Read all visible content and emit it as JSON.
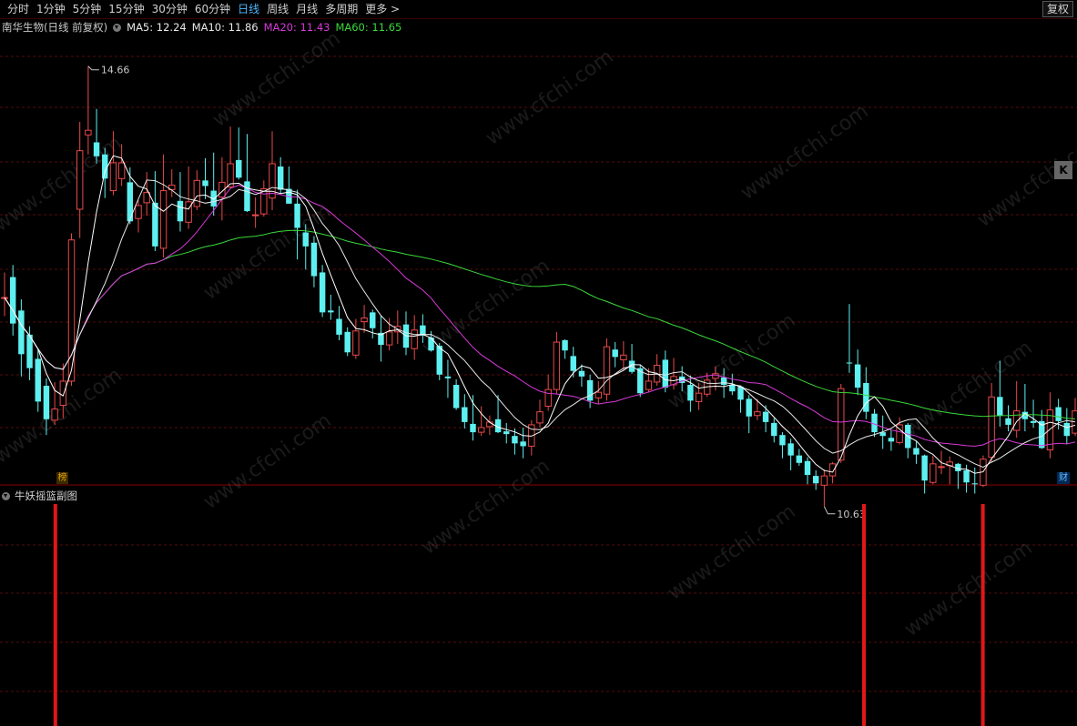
{
  "toolbar": {
    "periods": [
      "分时",
      "1分钟",
      "5分钟",
      "15分钟",
      "30分钟",
      "60分钟",
      "日线",
      "周线",
      "月线",
      "多周期",
      "更多 >"
    ],
    "active_index": 6,
    "right_button": "复权"
  },
  "main_panel": {
    "stock_title": "南华生物(日线 前复权)",
    "indicators": [
      {
        "label": "MA5: 12.24",
        "color": "#e8e8e8"
      },
      {
        "label": "MA10: 11.86",
        "color": "#e8e8e8"
      },
      {
        "label": "MA20: 11.43",
        "color": "#d83ad8"
      },
      {
        "label": "MA60: 11.65",
        "color": "#3ad83a"
      }
    ],
    "high_label": "14.66",
    "low_label": "10.63",
    "rank_badge": "榜",
    "finance_badge": "财",
    "side_icon": "K"
  },
  "sub_panel": {
    "title": "牛妖摇篮副图"
  },
  "watermark": "www.cfchi.com",
  "colors": {
    "up": "#e84a4a",
    "down": "#5ef0f0",
    "ma5": "#ffffff",
    "ma10": "#e8e8e8",
    "ma20": "#d83ad8",
    "ma60": "#3ad83a",
    "signal": "#e01818",
    "grid": "#5a0a0a"
  },
  "chart_data": {
    "type": "candlestick",
    "price_range": [
      10.3,
      15.0
    ],
    "candles": [
      [
        12.17,
        12.17,
        12.44,
        11.97
      ],
      [
        12.39,
        11.89,
        12.52,
        11.76
      ],
      [
        12.03,
        11.56,
        12.15,
        11.32
      ],
      [
        11.77,
        11.41,
        11.86,
        11.28
      ],
      [
        11.51,
        11.05,
        11.62,
        10.94
      ],
      [
        11.22,
        10.86,
        11.3,
        10.69
      ],
      [
        10.85,
        10.97,
        11.26,
        10.8
      ],
      [
        11.01,
        11.27,
        11.46,
        10.87
      ],
      [
        11.27,
        12.79,
        12.86,
        11.22
      ],
      [
        13.12,
        13.75,
        14.06,
        12.81
      ],
      [
        13.92,
        13.97,
        14.66,
        13.71
      ],
      [
        13.84,
        13.69,
        14.2,
        13.61
      ],
      [
        13.71,
        13.45,
        13.78,
        13.24
      ],
      [
        13.32,
        13.62,
        13.96,
        13.27
      ],
      [
        13.45,
        13.62,
        13.82,
        13.37
      ],
      [
        13.41,
        12.99,
        13.57,
        12.96
      ],
      [
        13.02,
        13.16,
        13.22,
        12.87
      ],
      [
        13.19,
        13.3,
        13.52,
        13.05
      ],
      [
        13.19,
        12.72,
        13.53,
        12.67
      ],
      [
        12.7,
        13.32,
        13.71,
        12.6
      ],
      [
        13.33,
        13.38,
        13.55,
        13.25
      ],
      [
        13.21,
        12.99,
        13.52,
        12.88
      ],
      [
        12.98,
        13.2,
        13.58,
        12.91
      ],
      [
        13.15,
        13.43,
        13.54,
        13.11
      ],
      [
        13.43,
        13.37,
        13.67,
        13.23
      ],
      [
        13.32,
        13.15,
        13.73,
        13.05
      ],
      [
        13.25,
        13.41,
        13.68,
        13.0
      ],
      [
        13.36,
        13.61,
        14.01,
        13.34
      ],
      [
        13.65,
        13.46,
        14.0,
        13.44
      ],
      [
        13.42,
        13.1,
        13.93,
        13.09
      ],
      [
        13.06,
        13.06,
        13.25,
        12.92
      ],
      [
        13.07,
        13.34,
        13.43,
        13.04
      ],
      [
        13.24,
        13.61,
        13.96,
        13.11
      ],
      [
        13.58,
        13.33,
        13.68,
        13.29
      ],
      [
        13.34,
        13.18,
        13.58,
        13.18
      ],
      [
        13.18,
        12.92,
        13.33,
        12.58
      ],
      [
        12.87,
        12.72,
        12.96,
        12.47
      ],
      [
        12.76,
        12.4,
        12.83,
        12.28
      ],
      [
        12.44,
        12.01,
        12.52,
        11.96
      ],
      [
        12.03,
        12.01,
        12.2,
        11.93
      ],
      [
        11.94,
        11.77,
        12.08,
        11.71
      ],
      [
        11.8,
        11.58,
        11.85,
        11.54
      ],
      [
        11.55,
        11.81,
        11.94,
        11.51
      ],
      [
        11.91,
        11.95,
        12.09,
        11.79
      ],
      [
        12.01,
        11.84,
        12.04,
        11.73
      ],
      [
        11.79,
        11.66,
        11.98,
        11.48
      ],
      [
        11.66,
        11.8,
        11.95,
        11.6
      ],
      [
        11.8,
        11.86,
        12.03,
        11.67
      ],
      [
        11.88,
        11.63,
        12.02,
        11.55
      ],
      [
        11.62,
        11.82,
        11.98,
        11.5
      ],
      [
        11.87,
        11.76,
        11.99,
        11.68
      ],
      [
        11.74,
        11.6,
        11.81,
        11.59
      ],
      [
        11.65,
        11.34,
        11.68,
        11.28
      ],
      [
        11.32,
        11.3,
        11.5,
        11.09
      ],
      [
        11.23,
        10.98,
        11.29,
        10.96
      ],
      [
        10.99,
        10.83,
        11.13,
        10.76
      ],
      [
        10.81,
        10.72,
        11.12,
        10.63
      ],
      [
        10.72,
        10.77,
        11.0,
        10.68
      ],
      [
        10.78,
        10.83,
        10.9,
        10.69
      ],
      [
        10.86,
        10.72,
        11.12,
        10.71
      ],
      [
        10.73,
        10.7,
        10.82,
        10.6
      ],
      [
        10.68,
        10.6,
        10.76,
        10.48
      ],
      [
        10.62,
        10.57,
        10.77,
        10.44
      ],
      [
        10.57,
        10.8,
        10.85,
        10.47
      ],
      [
        10.82,
        10.94,
        11.07,
        10.77
      ],
      [
        11.0,
        11.18,
        11.34,
        10.95
      ],
      [
        11.18,
        11.69,
        11.8,
        11.13
      ],
      [
        11.71,
        11.6,
        11.72,
        11.51
      ],
      [
        11.54,
        11.38,
        11.64,
        11.31
      ],
      [
        11.38,
        11.32,
        11.45,
        11.21
      ],
      [
        11.28,
        11.06,
        11.34,
        10.98
      ],
      [
        11.09,
        11.15,
        11.27,
        11.02
      ],
      [
        11.13,
        11.64,
        11.73,
        11.06
      ],
      [
        11.61,
        11.53,
        11.69,
        11.42
      ],
      [
        11.5,
        11.55,
        11.7,
        11.38
      ],
      [
        11.49,
        11.37,
        11.67,
        11.35
      ],
      [
        11.41,
        11.14,
        11.45,
        11.1
      ],
      [
        11.18,
        11.27,
        11.41,
        11.15
      ],
      [
        11.26,
        11.44,
        11.56,
        11.22
      ],
      [
        11.5,
        11.2,
        11.6,
        11.15
      ],
      [
        11.23,
        11.32,
        11.52,
        11.18
      ],
      [
        11.32,
        11.25,
        11.43,
        11.16
      ],
      [
        11.23,
        11.06,
        11.33,
        10.94
      ],
      [
        11.05,
        11.14,
        11.25,
        10.96
      ],
      [
        11.13,
        11.28,
        11.36,
        11.1
      ],
      [
        11.3,
        11.35,
        11.43,
        11.17
      ],
      [
        11.31,
        11.23,
        11.41,
        11.09
      ],
      [
        11.23,
        11.16,
        11.35,
        11.12
      ],
      [
        11.21,
        11.07,
        11.21,
        10.93
      ],
      [
        11.08,
        10.89,
        11.12,
        10.71
      ],
      [
        10.9,
        10.94,
        11.08,
        10.85
      ],
      [
        10.94,
        10.83,
        11.01,
        10.72
      ],
      [
        10.82,
        10.68,
        10.87,
        10.61
      ],
      [
        10.69,
        10.58,
        10.72,
        10.44
      ],
      [
        10.6,
        10.47,
        10.65,
        10.31
      ],
      [
        10.47,
        10.39,
        10.54,
        10.36
      ],
      [
        10.41,
        10.26,
        10.45,
        10.16
      ],
      [
        10.25,
        10.17,
        10.31,
        10.1
      ],
      [
        10.15,
        10.25,
        10.32,
        9.92
      ],
      [
        10.25,
        10.38,
        10.4,
        10.17
      ],
      [
        10.42,
        11.19,
        11.24,
        10.39
      ],
      [
        11.47,
        11.46,
        12.1,
        11.36
      ],
      [
        11.45,
        11.2,
        11.61,
        11.12
      ],
      [
        11.25,
        10.94,
        11.42,
        10.86
      ],
      [
        10.92,
        10.72,
        10.97,
        10.67
      ],
      [
        10.72,
        10.68,
        10.9,
        10.54
      ],
      [
        10.66,
        10.62,
        10.74,
        10.52
      ],
      [
        10.61,
        10.8,
        10.88,
        10.59
      ],
      [
        10.8,
        10.55,
        10.82,
        10.44
      ],
      [
        10.55,
        10.48,
        10.62,
        10.38
      ],
      [
        10.47,
        10.2,
        10.48,
        10.06
      ],
      [
        10.18,
        10.38,
        10.47,
        10.16
      ],
      [
        10.35,
        10.35,
        10.52,
        10.27
      ],
      [
        10.36,
        10.4,
        10.46,
        10.16
      ],
      [
        10.38,
        10.3,
        10.39,
        10.11
      ],
      [
        10.31,
        10.18,
        10.37,
        10.07
      ],
      [
        10.17,
        10.16,
        10.34,
        10.06
      ],
      [
        10.15,
        10.43,
        10.47,
        10.13
      ],
      [
        10.45,
        11.1,
        11.25,
        10.39
      ],
      [
        11.1,
        10.9,
        11.49,
        10.78
      ],
      [
        10.87,
        10.8,
        11.01,
        10.73
      ],
      [
        10.74,
        10.95,
        11.27,
        10.66
      ],
      [
        10.94,
        10.86,
        11.24,
        10.73
      ],
      [
        10.84,
        10.82,
        11.07,
        10.77
      ],
      [
        10.84,
        10.55,
        10.96,
        10.54
      ],
      [
        10.53,
        10.96,
        11.15,
        10.44
      ],
      [
        10.99,
        10.84,
        11.08,
        10.75
      ],
      [
        10.82,
        10.68,
        10.98,
        10.59
      ],
      [
        10.71,
        10.95,
        11.09,
        10.68
      ]
    ],
    "signal_bars": [
      0.0514,
      0.8022,
      0.9126
    ]
  }
}
